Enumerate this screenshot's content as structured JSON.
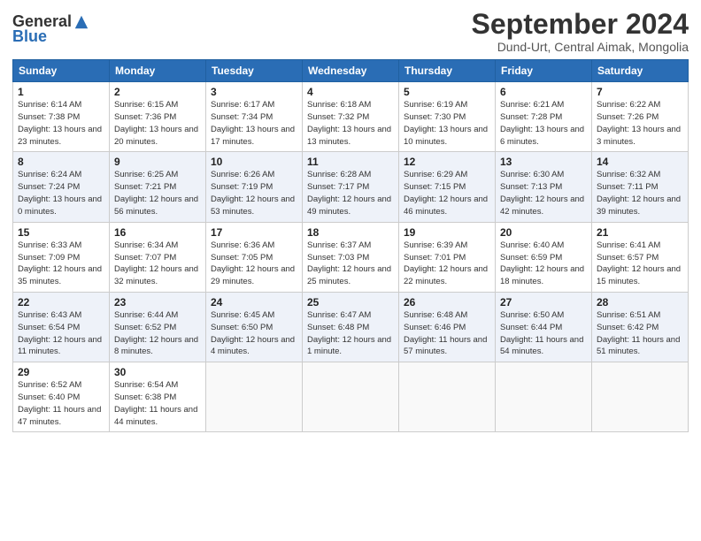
{
  "header": {
    "logo_general": "General",
    "logo_blue": "Blue",
    "month_title": "September 2024",
    "location": "Dund-Urt, Central Aimak, Mongolia"
  },
  "days_of_week": [
    "Sunday",
    "Monday",
    "Tuesday",
    "Wednesday",
    "Thursday",
    "Friday",
    "Saturday"
  ],
  "weeks": [
    [
      {
        "day": "1",
        "sunrise": "Sunrise: 6:14 AM",
        "sunset": "Sunset: 7:38 PM",
        "daylight": "Daylight: 13 hours and 23 minutes."
      },
      {
        "day": "2",
        "sunrise": "Sunrise: 6:15 AM",
        "sunset": "Sunset: 7:36 PM",
        "daylight": "Daylight: 13 hours and 20 minutes."
      },
      {
        "day": "3",
        "sunrise": "Sunrise: 6:17 AM",
        "sunset": "Sunset: 7:34 PM",
        "daylight": "Daylight: 13 hours and 17 minutes."
      },
      {
        "day": "4",
        "sunrise": "Sunrise: 6:18 AM",
        "sunset": "Sunset: 7:32 PM",
        "daylight": "Daylight: 13 hours and 13 minutes."
      },
      {
        "day": "5",
        "sunrise": "Sunrise: 6:19 AM",
        "sunset": "Sunset: 7:30 PM",
        "daylight": "Daylight: 13 hours and 10 minutes."
      },
      {
        "day": "6",
        "sunrise": "Sunrise: 6:21 AM",
        "sunset": "Sunset: 7:28 PM",
        "daylight": "Daylight: 13 hours and 6 minutes."
      },
      {
        "day": "7",
        "sunrise": "Sunrise: 6:22 AM",
        "sunset": "Sunset: 7:26 PM",
        "daylight": "Daylight: 13 hours and 3 minutes."
      }
    ],
    [
      {
        "day": "8",
        "sunrise": "Sunrise: 6:24 AM",
        "sunset": "Sunset: 7:24 PM",
        "daylight": "Daylight: 13 hours and 0 minutes."
      },
      {
        "day": "9",
        "sunrise": "Sunrise: 6:25 AM",
        "sunset": "Sunset: 7:21 PM",
        "daylight": "Daylight: 12 hours and 56 minutes."
      },
      {
        "day": "10",
        "sunrise": "Sunrise: 6:26 AM",
        "sunset": "Sunset: 7:19 PM",
        "daylight": "Daylight: 12 hours and 53 minutes."
      },
      {
        "day": "11",
        "sunrise": "Sunrise: 6:28 AM",
        "sunset": "Sunset: 7:17 PM",
        "daylight": "Daylight: 12 hours and 49 minutes."
      },
      {
        "day": "12",
        "sunrise": "Sunrise: 6:29 AM",
        "sunset": "Sunset: 7:15 PM",
        "daylight": "Daylight: 12 hours and 46 minutes."
      },
      {
        "day": "13",
        "sunrise": "Sunrise: 6:30 AM",
        "sunset": "Sunset: 7:13 PM",
        "daylight": "Daylight: 12 hours and 42 minutes."
      },
      {
        "day": "14",
        "sunrise": "Sunrise: 6:32 AM",
        "sunset": "Sunset: 7:11 PM",
        "daylight": "Daylight: 12 hours and 39 minutes."
      }
    ],
    [
      {
        "day": "15",
        "sunrise": "Sunrise: 6:33 AM",
        "sunset": "Sunset: 7:09 PM",
        "daylight": "Daylight: 12 hours and 35 minutes."
      },
      {
        "day": "16",
        "sunrise": "Sunrise: 6:34 AM",
        "sunset": "Sunset: 7:07 PM",
        "daylight": "Daylight: 12 hours and 32 minutes."
      },
      {
        "day": "17",
        "sunrise": "Sunrise: 6:36 AM",
        "sunset": "Sunset: 7:05 PM",
        "daylight": "Daylight: 12 hours and 29 minutes."
      },
      {
        "day": "18",
        "sunrise": "Sunrise: 6:37 AM",
        "sunset": "Sunset: 7:03 PM",
        "daylight": "Daylight: 12 hours and 25 minutes."
      },
      {
        "day": "19",
        "sunrise": "Sunrise: 6:39 AM",
        "sunset": "Sunset: 7:01 PM",
        "daylight": "Daylight: 12 hours and 22 minutes."
      },
      {
        "day": "20",
        "sunrise": "Sunrise: 6:40 AM",
        "sunset": "Sunset: 6:59 PM",
        "daylight": "Daylight: 12 hours and 18 minutes."
      },
      {
        "day": "21",
        "sunrise": "Sunrise: 6:41 AM",
        "sunset": "Sunset: 6:57 PM",
        "daylight": "Daylight: 12 hours and 15 minutes."
      }
    ],
    [
      {
        "day": "22",
        "sunrise": "Sunrise: 6:43 AM",
        "sunset": "Sunset: 6:54 PM",
        "daylight": "Daylight: 12 hours and 11 minutes."
      },
      {
        "day": "23",
        "sunrise": "Sunrise: 6:44 AM",
        "sunset": "Sunset: 6:52 PM",
        "daylight": "Daylight: 12 hours and 8 minutes."
      },
      {
        "day": "24",
        "sunrise": "Sunrise: 6:45 AM",
        "sunset": "Sunset: 6:50 PM",
        "daylight": "Daylight: 12 hours and 4 minutes."
      },
      {
        "day": "25",
        "sunrise": "Sunrise: 6:47 AM",
        "sunset": "Sunset: 6:48 PM",
        "daylight": "Daylight: 12 hours and 1 minute."
      },
      {
        "day": "26",
        "sunrise": "Sunrise: 6:48 AM",
        "sunset": "Sunset: 6:46 PM",
        "daylight": "Daylight: 11 hours and 57 minutes."
      },
      {
        "day": "27",
        "sunrise": "Sunrise: 6:50 AM",
        "sunset": "Sunset: 6:44 PM",
        "daylight": "Daylight: 11 hours and 54 minutes."
      },
      {
        "day": "28",
        "sunrise": "Sunrise: 6:51 AM",
        "sunset": "Sunset: 6:42 PM",
        "daylight": "Daylight: 11 hours and 51 minutes."
      }
    ],
    [
      {
        "day": "29",
        "sunrise": "Sunrise: 6:52 AM",
        "sunset": "Sunset: 6:40 PM",
        "daylight": "Daylight: 11 hours and 47 minutes."
      },
      {
        "day": "30",
        "sunrise": "Sunrise: 6:54 AM",
        "sunset": "Sunset: 6:38 PM",
        "daylight": "Daylight: 11 hours and 44 minutes."
      },
      null,
      null,
      null,
      null,
      null
    ]
  ]
}
